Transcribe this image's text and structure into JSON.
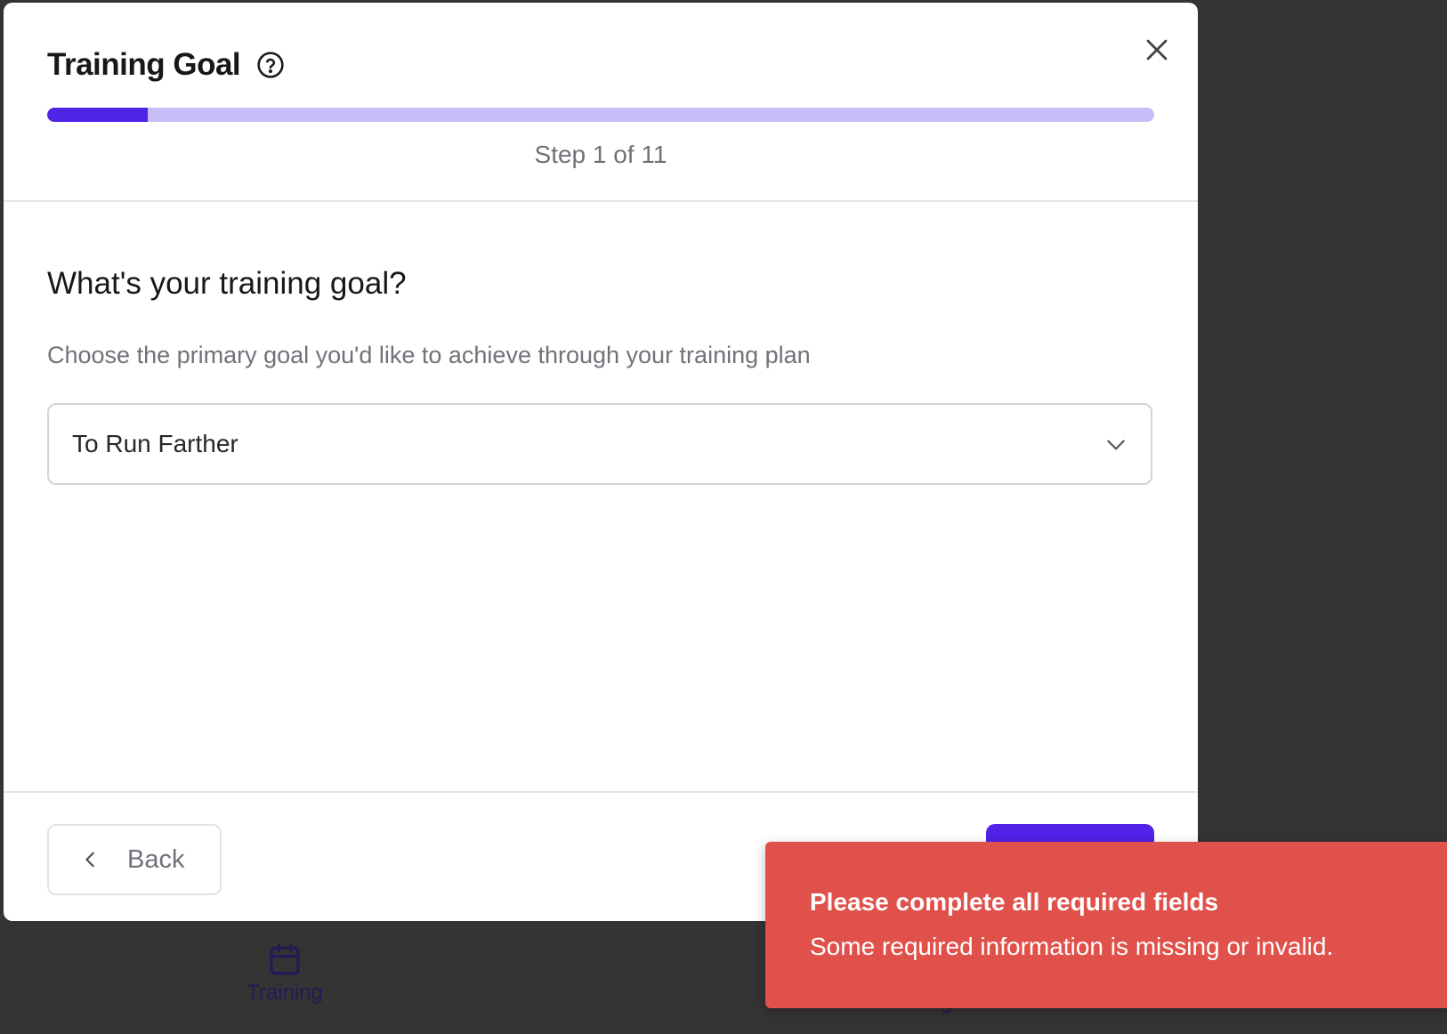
{
  "modal": {
    "title": "Training Goal",
    "progress_fraction": 0.0909,
    "step_label": "Step 1 of 11",
    "question": "What's your training goal?",
    "description": "Choose the primary goal you'd like to achieve through your training plan",
    "select": {
      "value": "To Run Farther"
    },
    "footer": {
      "back_label": "Back"
    },
    "colors": {
      "accent": "#4f24e6",
      "progress_track": "#c8bcf7"
    }
  },
  "bottom_nav": {
    "items": [
      {
        "label": "Training",
        "icon": "calendar-icon"
      },
      {
        "label": "Log"
      }
    ]
  },
  "toast": {
    "title": "Please complete all required fields",
    "message": "Some required information is missing or invalid.",
    "color": "#df514a"
  }
}
